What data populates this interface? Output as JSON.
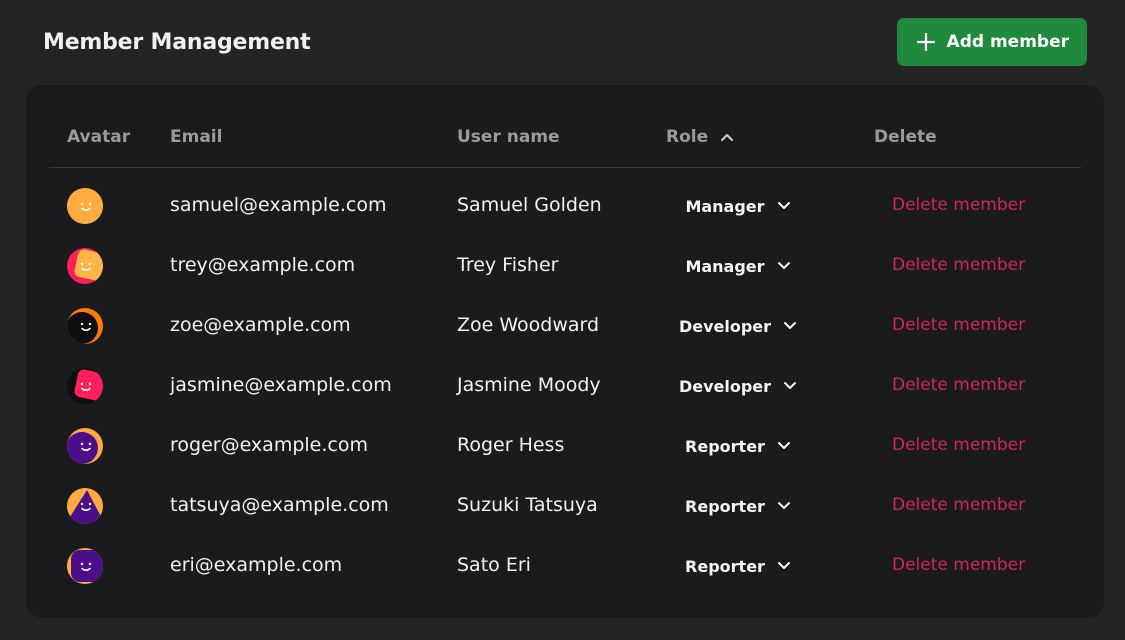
{
  "header": {
    "title": "Member Management",
    "add_button_label": "Add member"
  },
  "colors": {
    "accent_green": "#1f8a3c",
    "danger": "#d0245e",
    "background": "#242424",
    "card": "#1b1b1d"
  },
  "table": {
    "columns": {
      "avatar": "Avatar",
      "email": "Email",
      "username": "User name",
      "role": "Role",
      "delete": "Delete"
    },
    "sort": {
      "column": "role",
      "direction": "ascending",
      "icon": "chevron-up-icon"
    },
    "delete_label": "Delete member",
    "rows": [
      {
        "email": "samuel@example.com",
        "username": "Samuel Golden",
        "role": "Manager",
        "avatar": {
          "bg": "#ffab40",
          "fg": "#ffab40",
          "shape": "smile"
        }
      },
      {
        "email": "trey@example.com",
        "username": "Trey Fisher",
        "role": "Manager",
        "avatar": {
          "bg": "#ff1f5a",
          "fg": "#ffb547",
          "shape": "tilt-square"
        }
      },
      {
        "email": "zoe@example.com",
        "username": "Zoe Woodward",
        "role": "Developer",
        "avatar": {
          "bg": "#ff7b00",
          "fg": "#0e0e12",
          "shape": "circle"
        }
      },
      {
        "email": "jasmine@example.com",
        "username": "Jasmine Moody",
        "role": "Developer",
        "avatar": {
          "bg": "#0e0e12",
          "fg": "#ff1f5a",
          "shape": "tilt-square"
        }
      },
      {
        "email": "roger@example.com",
        "username": "Roger Hess",
        "role": "Reporter",
        "avatar": {
          "bg": "#ffab40",
          "fg": "#4b0f8a",
          "shape": "circle"
        }
      },
      {
        "email": "tatsuya@example.com",
        "username": "Suzuki Tatsuya",
        "role": "Reporter",
        "avatar": {
          "bg": "#ffab40",
          "fg": "#4b0f8a",
          "shape": "triangle"
        }
      },
      {
        "email": "eri@example.com",
        "username": "Sato Eri",
        "role": "Reporter",
        "avatar": {
          "bg": "#ffab40",
          "fg": "#4b0f8a",
          "shape": "rounded-square"
        }
      }
    ]
  }
}
